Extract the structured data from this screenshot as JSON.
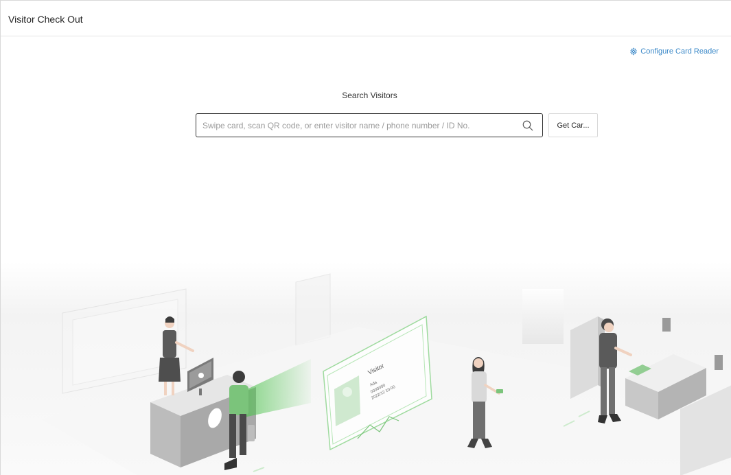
{
  "header": {
    "title": "Visitor Check Out"
  },
  "toolbar": {
    "configure_card_reader_label": "Configure Card Reader",
    "configure_card_reader_icon": "gear-icon"
  },
  "search": {
    "heading": "Search Visitors",
    "placeholder": "Swipe card, scan QR code, or enter visitor name / phone number / ID No.",
    "value": "",
    "icon": "search-icon",
    "get_card_label": "Get Car..."
  },
  "illustration": {
    "badge_title": "Visitor",
    "badge_line1": "Ada",
    "badge_line2": "0000000",
    "badge_line3": "2022/12   10:00"
  },
  "colors": {
    "accent_link": "#3a88c8",
    "scan_green": "#4cc24c",
    "border_dark": "#333333"
  }
}
